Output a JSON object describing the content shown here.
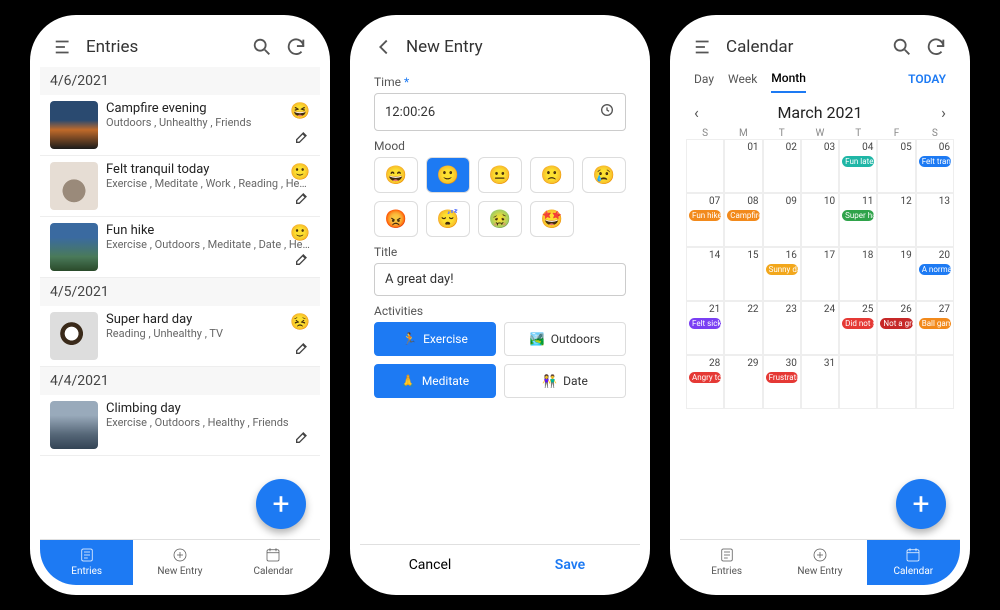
{
  "screens": {
    "entries": {
      "title": "Entries",
      "groups": [
        {
          "date": "4/6/2021",
          "items": [
            {
              "title": "Campfire evening",
              "tags": "Outdoors , Unhealthy , Friends",
              "mood": "😆"
            },
            {
              "title": "Felt tranquil today",
              "tags": "Exercise , Meditate , Work , Reading , Healt…",
              "mood": "🙂"
            },
            {
              "title": "Fun hike",
              "tags": "Exercise , Outdoors , Meditate , Date , Heal…",
              "mood": "🙂"
            }
          ]
        },
        {
          "date": "4/5/2021",
          "items": [
            {
              "title": "Super hard day",
              "tags": "Reading , Unhealthy , TV",
              "mood": "😣"
            }
          ]
        },
        {
          "date": "4/4/2021",
          "items": [
            {
              "title": "Climbing day",
              "tags": "Exercise , Outdoors , Healthy , Friends",
              "mood": ""
            }
          ]
        }
      ]
    },
    "new_entry": {
      "title": "New Entry",
      "time_label": "Time",
      "time_value": "12:00:26",
      "mood_label": "Mood",
      "moods": [
        "😄",
        "🙂",
        "😐",
        "🙁",
        "😢",
        "😡",
        "😴",
        "🤢",
        "🤩"
      ],
      "mood_selected_index": 1,
      "title_label": "Title",
      "title_value": "A great day!",
      "activities_label": "Activities",
      "activities": [
        {
          "icon": "🏃",
          "label": "Exercise",
          "sel": true
        },
        {
          "icon": "🏞️",
          "label": "Outdoors",
          "sel": false
        },
        {
          "icon": "🙏",
          "label": "Meditate",
          "sel": true
        },
        {
          "icon": "👫",
          "label": "Date",
          "sel": false
        }
      ],
      "cancel": "Cancel",
      "save": "Save"
    },
    "calendar": {
      "title": "Calendar",
      "view_tabs": [
        "Day",
        "Week",
        "Month"
      ],
      "active_view": "Month",
      "today": "TODAY",
      "month_label": "March 2021",
      "dow": [
        "S",
        "M",
        "T",
        "W",
        "T",
        "F",
        "S"
      ],
      "cells": [
        {
          "d": ""
        },
        {
          "d": "01"
        },
        {
          "d": "02"
        },
        {
          "d": "03"
        },
        {
          "d": "04",
          "ev": [
            {
              "t": "Fun late n",
              "c": "c-teal"
            }
          ]
        },
        {
          "d": "05"
        },
        {
          "d": "06",
          "ev": [
            {
              "t": "Felt tranq",
              "c": "c-blue"
            }
          ]
        },
        {
          "d": "07",
          "ev": [
            {
              "t": "Fun hike",
              "c": "c-orange"
            }
          ]
        },
        {
          "d": "08",
          "ev": [
            {
              "t": "Campfire",
              "c": "c-orange"
            }
          ]
        },
        {
          "d": "09"
        },
        {
          "d": "10"
        },
        {
          "d": "11",
          "ev": [
            {
              "t": "Super ha",
              "c": "c-green"
            }
          ]
        },
        {
          "d": "12"
        },
        {
          "d": "13"
        },
        {
          "d": "14"
        },
        {
          "d": "15"
        },
        {
          "d": "16",
          "ev": [
            {
              "t": "Sunny da",
              "c": "c-amber"
            }
          ]
        },
        {
          "d": "17"
        },
        {
          "d": "18"
        },
        {
          "d": "19"
        },
        {
          "d": "20",
          "ev": [
            {
              "t": "A normal",
              "c": "c-blue"
            }
          ]
        },
        {
          "d": "21",
          "ev": [
            {
              "t": "Felt sick",
              "c": "c-purple"
            }
          ]
        },
        {
          "d": "22"
        },
        {
          "d": "23"
        },
        {
          "d": "24"
        },
        {
          "d": "25",
          "ev": [
            {
              "t": "Did not s",
              "c": "c-red"
            }
          ]
        },
        {
          "d": "26",
          "ev": [
            {
              "t": "Not a gre",
              "c": "c-dred"
            }
          ]
        },
        {
          "d": "27",
          "ev": [
            {
              "t": "Ball gam",
              "c": "c-orange"
            }
          ]
        },
        {
          "d": "28",
          "ev": [
            {
              "t": "Angry tod",
              "c": "c-red"
            }
          ]
        },
        {
          "d": "29"
        },
        {
          "d": "30",
          "ev": [
            {
              "t": "Frustratin",
              "c": "c-red"
            }
          ]
        },
        {
          "d": "31"
        },
        {
          "d": ""
        },
        {
          "d": ""
        },
        {
          "d": ""
        }
      ]
    }
  },
  "bottomnav": {
    "entries": "Entries",
    "new_entry": "New Entry",
    "calendar": "Calendar"
  }
}
